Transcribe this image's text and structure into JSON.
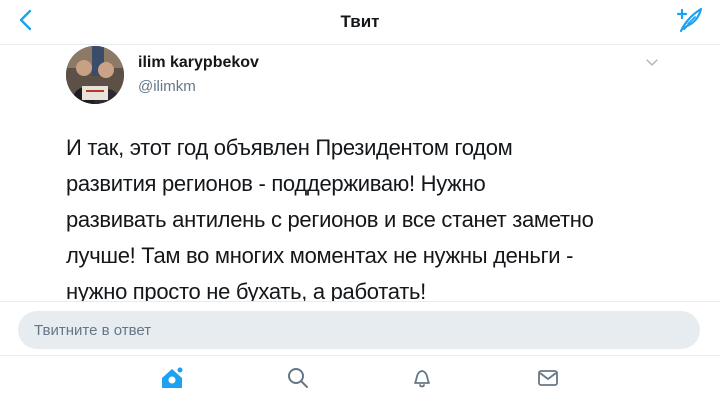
{
  "header": {
    "title": "Твит",
    "back_icon": "chevron-left-icon",
    "compose_icon": "compose-feather-icon"
  },
  "tweet": {
    "display_name": "ilim karypbekov",
    "handle": "@ilimkm",
    "menu_icon": "chevron-down-icon",
    "text_lines": [
      "И так, этот год объявлен Президентом годом",
      "развития регионов - поддерживаю! Нужно",
      "развивать антилень с регионов и все станет заметно",
      "лучше! Там во многих моментах не нужны деньги -",
      "нужно просто не бухать, а работать!"
    ]
  },
  "reply": {
    "placeholder": "Твитните в ответ"
  },
  "tabbar": {
    "items": [
      {
        "icon": "home-icon",
        "active": true
      },
      {
        "icon": "search-icon",
        "active": false
      },
      {
        "icon": "notifications-bell-icon",
        "active": false
      },
      {
        "icon": "messages-envelope-icon",
        "active": false
      }
    ]
  },
  "colors": {
    "accent": "#1da1f2",
    "text": "#14171a",
    "secondary": "#657786",
    "divider": "#e6ecf0"
  }
}
